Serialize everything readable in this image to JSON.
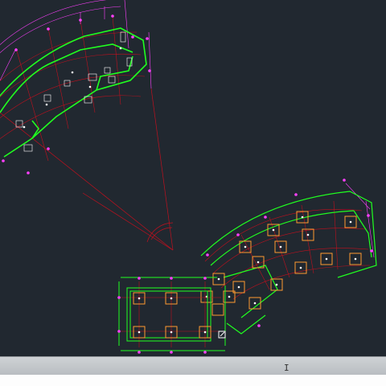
{
  "app": {
    "name": "CAD model space"
  },
  "command_line": {
    "value": "",
    "cursor_icon": "I"
  },
  "colors": {
    "background": "#212830",
    "wall_green": "#20ff20",
    "grid_red": "#c0101e",
    "dimension_magenta": "#ff40ff",
    "column_orange": "#ff9a30",
    "text_white": "#ffffff"
  },
  "icons": {
    "ucs": "ucs-icon",
    "text_cursor": "ibeam-cursor-icon"
  }
}
